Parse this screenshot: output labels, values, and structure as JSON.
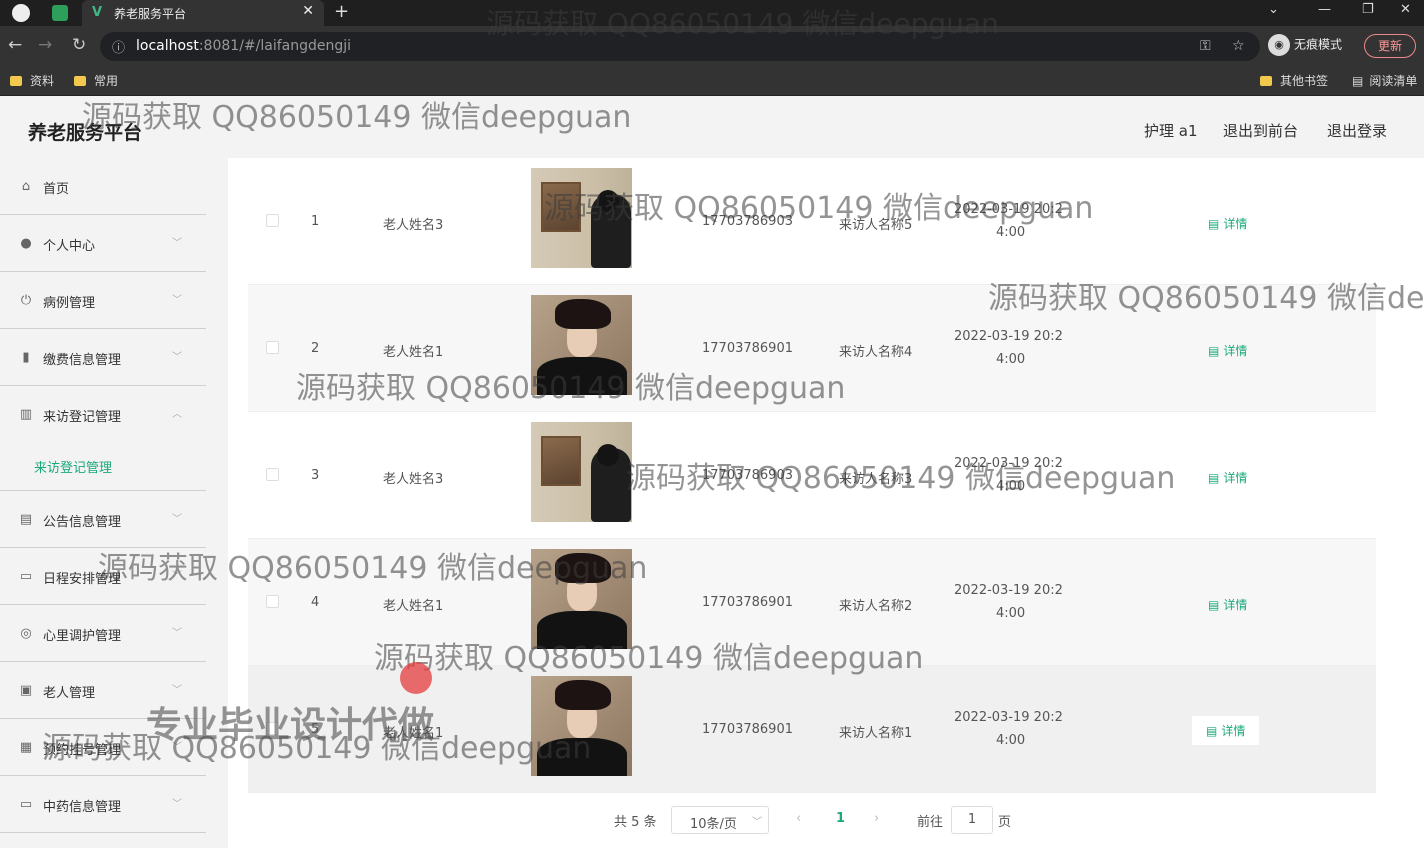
{
  "browser": {
    "tab_title": "养老服务平台",
    "url_host": "localhost",
    "url_rest": ":8081/#/laifangdengji",
    "incognito_label": "无痕模式",
    "update_label": "更新",
    "bookmarks": [
      "资料",
      "常用"
    ],
    "bookmarks_right": [
      "其他书签",
      "阅读清单"
    ]
  },
  "app": {
    "title": "养老服务平台",
    "header_links": [
      "护理 a1",
      "退出到前台",
      "退出登录"
    ]
  },
  "sidebar": {
    "items": [
      {
        "label": "首页",
        "icon": "home-icon"
      },
      {
        "label": "个人中心",
        "icon": "user-icon"
      },
      {
        "label": "病例管理",
        "icon": "power-icon"
      },
      {
        "label": "缴费信息管理",
        "icon": "bar-icon"
      },
      {
        "label": "来访登记管理",
        "icon": "chart-icon"
      },
      {
        "label": "公告信息管理",
        "icon": "clipboard-icon"
      },
      {
        "label": "日程安排管理",
        "icon": "briefcase-icon"
      },
      {
        "label": "心里调护管理",
        "icon": "compass-icon"
      },
      {
        "label": "老人管理",
        "icon": "doc-x-icon"
      },
      {
        "label": "预约挂号管理",
        "icon": "grid-icon"
      },
      {
        "label": "中药信息管理",
        "icon": "card-icon"
      }
    ],
    "sub_item": "来访登记管理"
  },
  "table": {
    "detail_label": "详情",
    "rows": [
      {
        "index": "1",
        "elder_name": "老人姓名3",
        "photo": "gallery",
        "phone": "17703786903",
        "visitor": "来访人名称5",
        "time_line1": "2022-03-19 20:2",
        "time_line2": "4:00"
      },
      {
        "index": "2",
        "elder_name": "老人姓名1",
        "photo": "portrait",
        "phone": "17703786901",
        "visitor": "来访人名称4",
        "time_line1": "2022-03-19 20:2",
        "time_line2": "4:00"
      },
      {
        "index": "3",
        "elder_name": "老人姓名3",
        "photo": "gallery",
        "phone": "17703786903",
        "visitor": "来访人名称3",
        "time_line1": "2022-03-19 20:2",
        "time_line2": "4:00"
      },
      {
        "index": "4",
        "elder_name": "老人姓名1",
        "photo": "portrait",
        "phone": "17703786901",
        "visitor": "来访人名称2",
        "time_line1": "2022-03-19 20:2",
        "time_line2": "4:00"
      },
      {
        "index": "5",
        "elder_name": "老人姓名1",
        "photo": "portrait",
        "phone": "17703786901",
        "visitor": "来访人名称1",
        "time_line1": "2022-03-19 20:2",
        "time_line2": "4:00"
      }
    ]
  },
  "pagination": {
    "total": "共 5 条",
    "page_size": "10条/页",
    "current_page": "1",
    "goto_label": "前往",
    "goto_value": "1",
    "page_unit": "页"
  },
  "watermarks": {
    "text": "源码获取 QQ86050149 微信deepguan",
    "overlay": "专业毕业设计代做"
  }
}
